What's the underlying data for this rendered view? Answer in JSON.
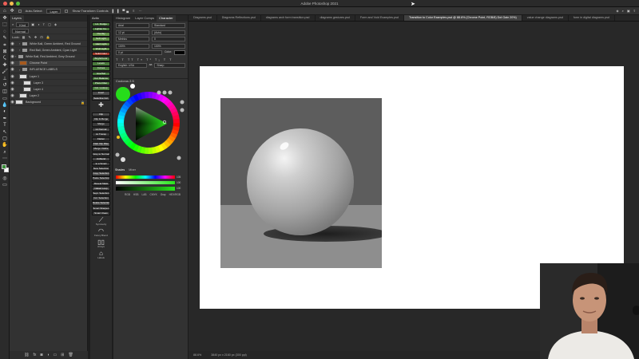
{
  "window": {
    "title": "Adobe Photoshop 2021"
  },
  "options_bar": {
    "auto_select_label": "Auto-Select:",
    "auto_select_value": "Layer",
    "transform_controls_label": "Show Transform Controls"
  },
  "layers_panel": {
    "tabs": [
      "Layers"
    ],
    "filter_label": "Kind",
    "blend_mode": "Normal",
    "lock_label": "Lock:",
    "rows": [
      {
        "name": "White Ball, Green Ambient, Red Ground",
        "type": "folder",
        "depth": 1
      },
      {
        "name": "Red Ball, Green Ambient, Cyan Light",
        "type": "folder",
        "depth": 1
      },
      {
        "name": "White Ball, Red Ambient, Grey Ground",
        "type": "folder",
        "depth": 0
      },
      {
        "name": "Chrome Point",
        "type": "layer",
        "depth": 1,
        "variant": "orange",
        "selected": true
      },
      {
        "name": "INFLUENCE LABELS",
        "type": "folder",
        "depth": 1
      },
      {
        "name": "Layer 1",
        "type": "layer",
        "depth": 1
      },
      {
        "name": "Layer 3",
        "type": "layer",
        "depth": 2
      },
      {
        "name": "Layer 4",
        "type": "layer",
        "depth": 2
      },
      {
        "name": "Layer 2",
        "type": "layer",
        "depth": 1
      },
      {
        "name": "Background",
        "type": "layer",
        "depth": 0,
        "locked": true
      }
    ]
  },
  "actions_panel": {
    "header": "Actio",
    "buttons": [
      {
        "label": "Lin. Dodge",
        "style": "green"
      },
      {
        "label": "Lighter Co.",
        "style": "green"
      },
      {
        "label": "Overlay",
        "style": "green2"
      },
      {
        "label": "Soft Light",
        "style": "green2"
      },
      {
        "label": "Hard Light",
        "style": "green2"
      },
      {
        "label": "Vivid Light",
        "style": "green2"
      },
      {
        "label": "Solid Color",
        "style": "red"
      },
      {
        "label": "Bright/Contr",
        "style": "green"
      },
      {
        "label": "Levels",
        "style": "green"
      },
      {
        "label": "Curves",
        "style": "green"
      },
      {
        "label": "Hue/Sat",
        "style": "green"
      },
      {
        "label": "Col. Balance",
        "style": "green"
      },
      {
        "label": "Photo Filter",
        "style": "green"
      },
      {
        "label": "Col. Lookup",
        "style": "green"
      },
      {
        "label": "Invert",
        "style": "gray"
      },
      {
        "label": "Selective Col.",
        "style": "gray"
      }
    ],
    "lower_buttons": [
      "Clip",
      "Clip & Merge",
      "Merge",
      "Lk Normal",
      "Lk Transp",
      "Flatten",
      "Flatt Clip Rlse",
      "Merge Visible",
      "Grey to Normal",
      "Unblend",
      "to a Smart",
      "New Selection",
      "Copy Selection",
      "Paste Selection",
      "Reveal Mask",
      "Naked Loop",
      "Sept. Selection",
      "Col. Selection",
      "Delete Selection",
      "Smart Sharpen",
      "Smart Clean"
    ],
    "icon_labels": [
      "Symmetry",
      "Fancy Blend",
      "Arrays",
      "Labels"
    ]
  },
  "color_panel": {
    "tabs": [
      "Histogram",
      "Layer Comps",
      "Character"
    ],
    "active_tab": "Character",
    "character": {
      "font_family": "Arial",
      "font_style": "Standard",
      "font_size": "12 pt",
      "leading": "(Auto)",
      "kerning": "Metrics",
      "tracking": "0",
      "vertical_scale": "100%",
      "horizontal_scale": "100%",
      "baseline": "0 pt",
      "color_label": "Color:",
      "language": "English: USA",
      "aa_label": "aa",
      "aa_value": "Sharp"
    },
    "coolorus_title": "Coolorus 2.5",
    "current_color": "#26dd1a",
    "shades_tabs": [
      "Shades",
      "Mixer"
    ],
    "sliders": [
      {
        "gradient": "hue",
        "value": "105"
      },
      {
        "gradient": "sat",
        "value": "100"
      },
      {
        "gradient": "bri",
        "value": "100"
      }
    ],
    "mode_labels": [
      "RGB",
      "HSB",
      "LAB",
      "CMYK",
      "Gray"
    ],
    "misc_label": "HEX/RGB"
  },
  "document_tabs": [
    {
      "label": "Diagrams.psd",
      "active": false
    },
    {
      "label": "Diagrams Reflections.psd",
      "active": false
    },
    {
      "label": "diagrams arch form transition.psd",
      "active": false
    },
    {
      "label": "diagrams gestures.psd",
      "active": false
    },
    {
      "label": "Form and Void Examples.psd",
      "active": false
    },
    {
      "label": "Transition to Color Examples.psd @ 88.6% (Chrome Point, RGB/8) Dot Gain 20%)",
      "active": true
    },
    {
      "label": "value change diagrams.psd",
      "active": false
    },
    {
      "label": "form in digital diagrams.psd",
      "active": false
    }
  ],
  "status_bar": {
    "zoom": "88.6%",
    "doc_size": "3840 px x 2160 px (300 ppi)"
  },
  "colors": {
    "accent_orange": "#a65a1e",
    "traffic_red": "#ee5f57",
    "traffic_yellow": "#f5be4f",
    "traffic_green": "#58c03d"
  }
}
